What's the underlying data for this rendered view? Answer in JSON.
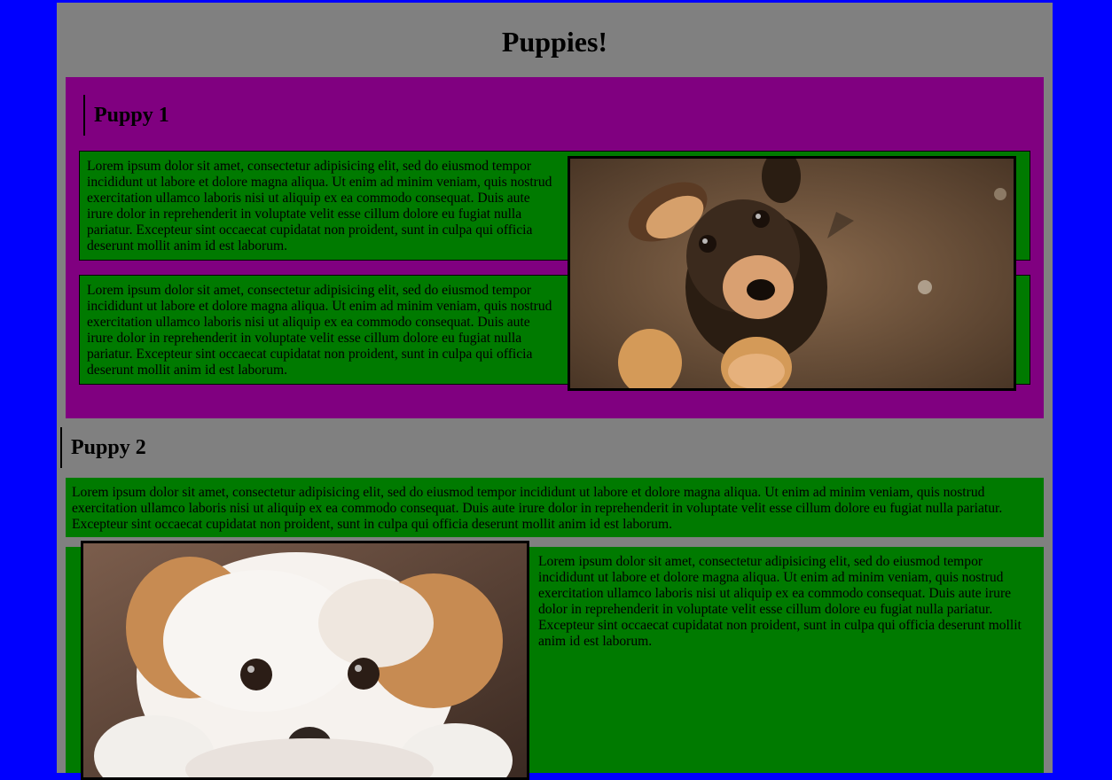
{
  "page": {
    "title": "Puppies!"
  },
  "sections": {
    "puppy1": {
      "heading": "Puppy 1",
      "paragraph1": "Lorem ipsum dolor sit amet, consectetur adipisicing elit, sed do eiusmod tempor incididunt ut labore et dolore magna aliqua. Ut enim ad minim veniam, quis nostrud exercitation ullamco laboris nisi ut aliquip ex ea commodo consequat. Duis aute irure dolor in reprehenderit in voluptate velit esse cillum dolore eu fugiat nulla pariatur. Excepteur sint occaecat cupidatat non proident, sunt in culpa qui officia deserunt mollit anim id est laborum.",
      "paragraph2": "Lorem ipsum dolor sit amet, consectetur adipisicing elit, sed do eiusmod tempor incididunt ut labore et dolore magna aliqua. Ut enim ad minim veniam, quis nostrud exercitation ullamco laboris nisi ut aliquip ex ea commodo consequat. Duis aute irure dolor in reprehenderit in voluptate velit esse cillum dolore eu fugiat nulla pariatur. Excepteur sint occaecat cupidatat non proident, sunt in culpa qui officia deserunt mollit anim id est laborum."
    },
    "puppy2": {
      "heading": "Puppy 2",
      "paragraph1": "Lorem ipsum dolor sit amet, consectetur adipisicing elit, sed do eiusmod tempor incididunt ut labore et dolore magna aliqua. Ut enim ad minim veniam, quis nostrud exercitation ullamco laboris nisi ut aliquip ex ea commodo consequat. Duis aute irure dolor in reprehenderit in voluptate velit esse cillum dolore eu fugiat nulla pariatur. Excepteur sint occaecat cupidatat non proident, sunt in culpa qui officia deserunt mollit anim id est laborum.",
      "paragraph2": "Lorem ipsum dolor sit amet, consectetur adipisicing elit, sed do eiusmod tempor incididunt ut labore et dolore magna aliqua. Ut enim ad minim veniam, quis nostrud exercitation ullamco laboris nisi ut aliquip ex ea commodo consequat. Duis aute irure dolor in reprehenderit in voluptate velit esse cillum dolore eu fugiat nulla pariatur. Excepteur sint occaecat cupidatat non proident, sunt in culpa qui officia deserunt mollit anim id est laborum."
    }
  },
  "colors": {
    "background": "#0000ff",
    "page": "#808080",
    "section": "#800080",
    "box": "#007a00"
  }
}
